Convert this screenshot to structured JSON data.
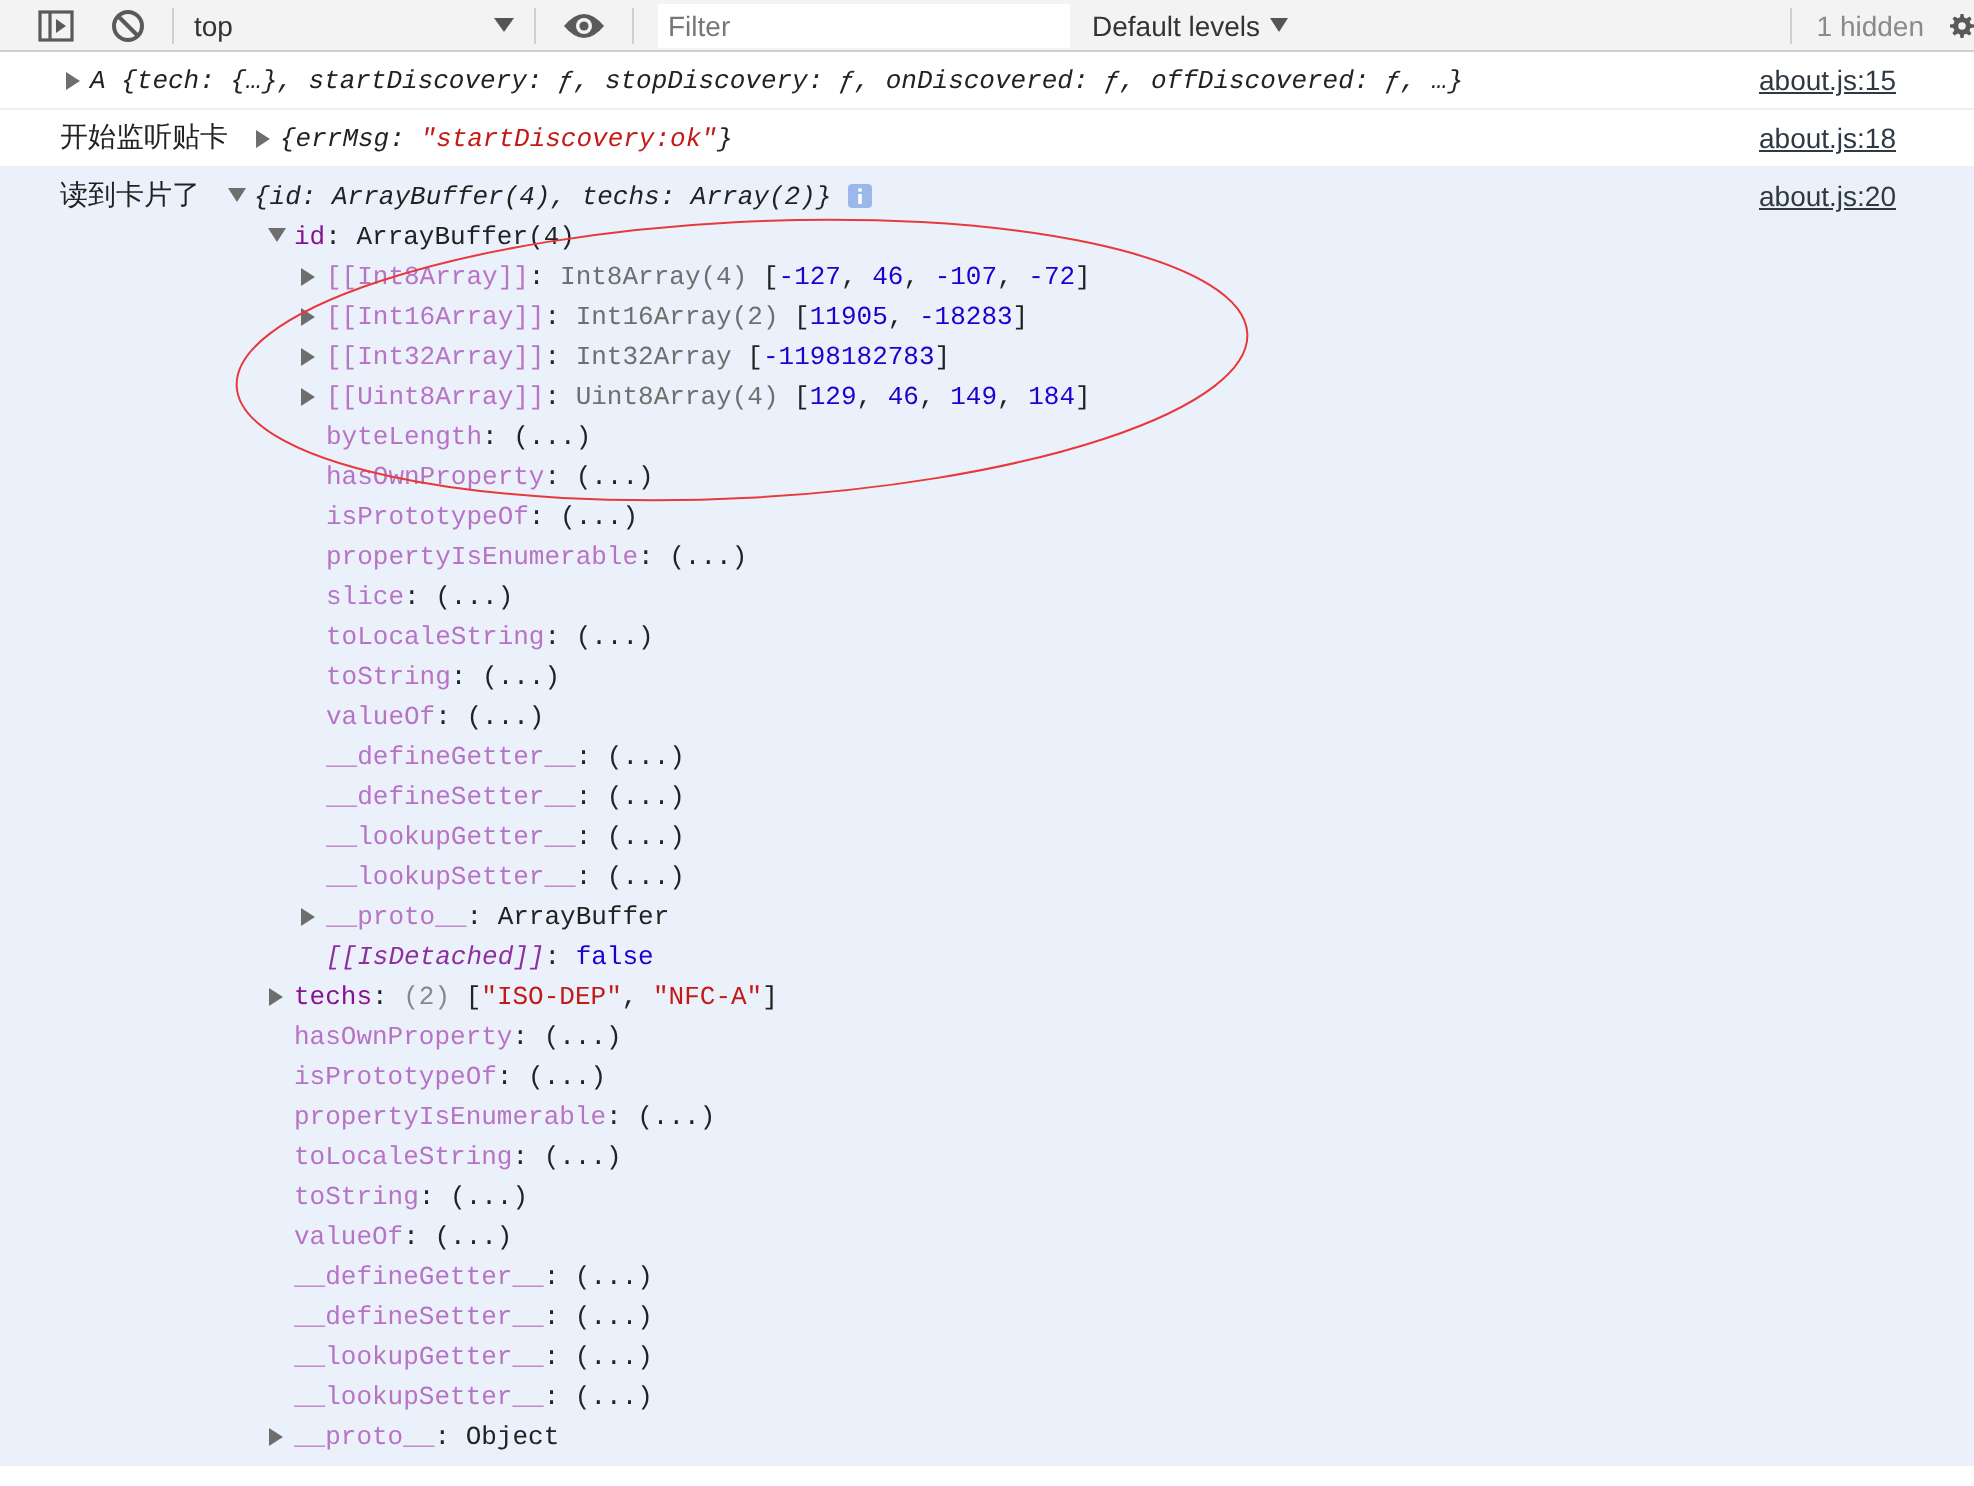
{
  "toolbar": {
    "context": "top",
    "filter": {
      "placeholder": "Filter"
    },
    "levels": "Default levels",
    "hidden_count": "1 hidden"
  },
  "messages": [
    {
      "expanded": false,
      "highlighted": false,
      "preview": [
        {
          "text": "A {tech: {…}, startDiscovery: ƒ, stopDiscovery: ƒ, onDiscovered: ƒ, offDiscovered: ƒ, …}",
          "kind": "plain"
        }
      ],
      "source": "about.js:15"
    },
    {
      "label": "开始监听贴卡",
      "expanded": false,
      "highlighted": false,
      "preview": [
        {
          "text": "{errMsg: ",
          "kind": "plain"
        },
        {
          "text": "\"startDiscovery:ok\"",
          "kind": "str"
        },
        {
          "text": "}",
          "kind": "plain"
        }
      ],
      "source": "about.js:18"
    },
    {
      "label": "读到卡片了",
      "expanded": true,
      "highlighted": true,
      "info_badge": true,
      "preview": [
        {
          "text": "{id: ArrayBuffer(4), techs: Array(2)}",
          "kind": "plain"
        }
      ],
      "source": "about.js:20",
      "children": [
        {
          "kind": "branch",
          "expanded": true,
          "tokens": [
            {
              "text": "id",
              "kind": "own"
            },
            {
              "text": ": ArrayBuffer(4)",
              "kind": "plain"
            }
          ],
          "children": [
            {
              "kind": "branch",
              "expanded": false,
              "tokens": [
                {
                  "text": "[[Int8Array]]",
                  "kind": "hidden"
                },
                {
                  "text": ": ",
                  "kind": "plain"
                },
                {
                  "text": "Int8Array(4) ",
                  "kind": "muted"
                },
                {
                  "text": "[",
                  "kind": "plain"
                },
                {
                  "text": "-127",
                  "kind": "num"
                },
                {
                  "text": ", ",
                  "kind": "plain"
                },
                {
                  "text": "46",
                  "kind": "num"
                },
                {
                  "text": ", ",
                  "kind": "plain"
                },
                {
                  "text": "-107",
                  "kind": "num"
                },
                {
                  "text": ", ",
                  "kind": "plain"
                },
                {
                  "text": "-72",
                  "kind": "num"
                },
                {
                  "text": "]",
                  "kind": "plain"
                }
              ]
            },
            {
              "kind": "branch",
              "expanded": false,
              "tokens": [
                {
                  "text": "[[Int16Array]]",
                  "kind": "hidden"
                },
                {
                  "text": ": ",
                  "kind": "plain"
                },
                {
                  "text": "Int16Array(2) ",
                  "kind": "muted"
                },
                {
                  "text": "[",
                  "kind": "plain"
                },
                {
                  "text": "11905",
                  "kind": "num"
                },
                {
                  "text": ", ",
                  "kind": "plain"
                },
                {
                  "text": "-18283",
                  "kind": "num"
                },
                {
                  "text": "]",
                  "kind": "plain"
                }
              ]
            },
            {
              "kind": "branch",
              "expanded": false,
              "tokens": [
                {
                  "text": "[[Int32Array]]",
                  "kind": "hidden"
                },
                {
                  "text": ": ",
                  "kind": "plain"
                },
                {
                  "text": "Int32Array ",
                  "kind": "muted"
                },
                {
                  "text": "[",
                  "kind": "plain"
                },
                {
                  "text": "-1198182783",
                  "kind": "num"
                },
                {
                  "text": "]",
                  "kind": "plain"
                }
              ]
            },
            {
              "kind": "branch",
              "expanded": false,
              "tokens": [
                {
                  "text": "[[Uint8Array]]",
                  "kind": "hidden"
                },
                {
                  "text": ": ",
                  "kind": "plain"
                },
                {
                  "text": "Uint8Array(4) ",
                  "kind": "muted"
                },
                {
                  "text": "[",
                  "kind": "plain"
                },
                {
                  "text": "129",
                  "kind": "num"
                },
                {
                  "text": ", ",
                  "kind": "plain"
                },
                {
                  "text": "46",
                  "kind": "num"
                },
                {
                  "text": ", ",
                  "kind": "plain"
                },
                {
                  "text": "149",
                  "kind": "num"
                },
                {
                  "text": ", ",
                  "kind": "plain"
                },
                {
                  "text": "184",
                  "kind": "num"
                },
                {
                  "text": "]",
                  "kind": "plain"
                }
              ]
            },
            {
              "kind": "leaf",
              "tokens": [
                {
                  "text": "byteLength",
                  "kind": "hidden"
                },
                {
                  "text": ": (...)",
                  "kind": "plain"
                }
              ]
            },
            {
              "kind": "leaf",
              "tokens": [
                {
                  "text": "hasOwnProperty",
                  "kind": "hidden"
                },
                {
                  "text": ": (...)",
                  "kind": "plain"
                }
              ]
            },
            {
              "kind": "leaf",
              "tokens": [
                {
                  "text": "isPrototypeOf",
                  "kind": "hidden"
                },
                {
                  "text": ": (...)",
                  "kind": "plain"
                }
              ]
            },
            {
              "kind": "leaf",
              "tokens": [
                {
                  "text": "propertyIsEnumerable",
                  "kind": "hidden"
                },
                {
                  "text": ": (...)",
                  "kind": "plain"
                }
              ]
            },
            {
              "kind": "leaf",
              "tokens": [
                {
                  "text": "slice",
                  "kind": "hidden"
                },
                {
                  "text": ": (...)",
                  "kind": "plain"
                }
              ]
            },
            {
              "kind": "leaf",
              "tokens": [
                {
                  "text": "toLocaleString",
                  "kind": "hidden"
                },
                {
                  "text": ": (...)",
                  "kind": "plain"
                }
              ]
            },
            {
              "kind": "leaf",
              "tokens": [
                {
                  "text": "toString",
                  "kind": "hidden"
                },
                {
                  "text": ": (...)",
                  "kind": "plain"
                }
              ]
            },
            {
              "kind": "leaf",
              "tokens": [
                {
                  "text": "valueOf",
                  "kind": "hidden"
                },
                {
                  "text": ": (...)",
                  "kind": "plain"
                }
              ]
            },
            {
              "kind": "leaf",
              "tokens": [
                {
                  "text": "__defineGetter__",
                  "kind": "hidden"
                },
                {
                  "text": ": (...)",
                  "kind": "plain"
                }
              ]
            },
            {
              "kind": "leaf",
              "tokens": [
                {
                  "text": "__defineSetter__",
                  "kind": "hidden"
                },
                {
                  "text": ": (...)",
                  "kind": "plain"
                }
              ]
            },
            {
              "kind": "leaf",
              "tokens": [
                {
                  "text": "__lookupGetter__",
                  "kind": "hidden"
                },
                {
                  "text": ": (...)",
                  "kind": "plain"
                }
              ]
            },
            {
              "kind": "leaf",
              "tokens": [
                {
                  "text": "__lookupSetter__",
                  "kind": "hidden"
                },
                {
                  "text": ": (...)",
                  "kind": "plain"
                }
              ]
            },
            {
              "kind": "branch",
              "expanded": false,
              "tokens": [
                {
                  "text": "__proto__",
                  "kind": "hidden"
                },
                {
                  "text": ": ArrayBuffer",
                  "kind": "plain"
                }
              ]
            },
            {
              "kind": "leaf",
              "tokens": [
                {
                  "text": "[[IsDetached]]",
                  "kind": "internal"
                },
                {
                  "text": ": ",
                  "kind": "plain"
                },
                {
                  "text": "false",
                  "kind": "num"
                }
              ]
            }
          ]
        },
        {
          "kind": "branch",
          "expanded": false,
          "tokens": [
            {
              "text": "techs",
              "kind": "own"
            },
            {
              "text": ": ",
              "kind": "plain"
            },
            {
              "text": "(2) ",
              "kind": "dim"
            },
            {
              "text": "[",
              "kind": "plain"
            },
            {
              "text": "\"ISO-DEP\"",
              "kind": "str"
            },
            {
              "text": ", ",
              "kind": "plain"
            },
            {
              "text": "\"NFC-A\"",
              "kind": "str"
            },
            {
              "text": "]",
              "kind": "plain"
            }
          ]
        },
        {
          "kind": "leaf",
          "tokens": [
            {
              "text": "hasOwnProperty",
              "kind": "hidden"
            },
            {
              "text": ": (...)",
              "kind": "plain"
            }
          ]
        },
        {
          "kind": "leaf",
          "tokens": [
            {
              "text": "isPrototypeOf",
              "kind": "hidden"
            },
            {
              "text": ": (...)",
              "kind": "plain"
            }
          ]
        },
        {
          "kind": "leaf",
          "tokens": [
            {
              "text": "propertyIsEnumerable",
              "kind": "hidden"
            },
            {
              "text": ": (...)",
              "kind": "plain"
            }
          ]
        },
        {
          "kind": "leaf",
          "tokens": [
            {
              "text": "toLocaleString",
              "kind": "hidden"
            },
            {
              "text": ": (...)",
              "kind": "plain"
            }
          ]
        },
        {
          "kind": "leaf",
          "tokens": [
            {
              "text": "toString",
              "kind": "hidden"
            },
            {
              "text": ": (...)",
              "kind": "plain"
            }
          ]
        },
        {
          "kind": "leaf",
          "tokens": [
            {
              "text": "valueOf",
              "kind": "hidden"
            },
            {
              "text": ": (...)",
              "kind": "plain"
            }
          ]
        },
        {
          "kind": "leaf",
          "tokens": [
            {
              "text": "__defineGetter__",
              "kind": "hidden"
            },
            {
              "text": ": (...)",
              "kind": "plain"
            }
          ]
        },
        {
          "kind": "leaf",
          "tokens": [
            {
              "text": "__defineSetter__",
              "kind": "hidden"
            },
            {
              "text": ": (...)",
              "kind": "plain"
            }
          ]
        },
        {
          "kind": "leaf",
          "tokens": [
            {
              "text": "__lookupGetter__",
              "kind": "hidden"
            },
            {
              "text": ": (...)",
              "kind": "plain"
            }
          ]
        },
        {
          "kind": "leaf",
          "tokens": [
            {
              "text": "__lookupSetter__",
              "kind": "hidden"
            },
            {
              "text": ": (...)",
              "kind": "plain"
            }
          ]
        },
        {
          "kind": "branch",
          "expanded": false,
          "tokens": [
            {
              "text": "__proto__",
              "kind": "hidden"
            },
            {
              "text": ": Object",
              "kind": "plain"
            }
          ]
        }
      ]
    }
  ],
  "annotations": [
    {
      "kind": "ellipse"
    }
  ]
}
